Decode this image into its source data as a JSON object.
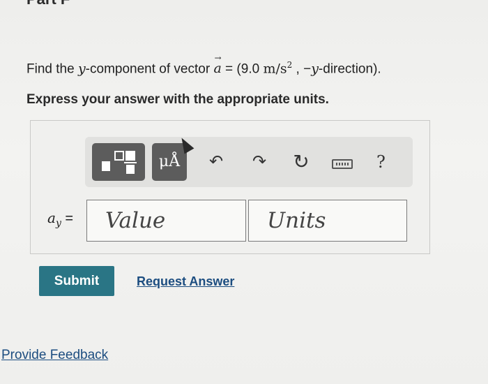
{
  "part": {
    "title": "Part F"
  },
  "question": {
    "prefix": "Find the ",
    "y_var": "y",
    "middle": "-component of vector ",
    "vector": "a",
    "equals": " = (9.0 ",
    "unit": "m/s",
    "exponent": "2",
    "sep": " , −",
    "y_var2": "y",
    "suffix": "-direction)."
  },
  "instructions": "Express your answer with the appropriate units.",
  "toolbar": {
    "units_label": "μÅ",
    "tools": [
      {
        "name": "undo-icon",
        "glyph": "↶"
      },
      {
        "name": "redo-icon",
        "glyph": "↷"
      },
      {
        "name": "reset-icon",
        "glyph": "↻"
      },
      {
        "name": "keyboard-icon",
        "glyph": ""
      },
      {
        "name": "help-icon",
        "glyph": "?"
      }
    ]
  },
  "answer": {
    "var_label": "a",
    "var_sub": "y",
    "equals": " =",
    "value_placeholder": "Value",
    "units_placeholder": "Units"
  },
  "actions": {
    "submit_label": "Submit",
    "request_answer_label": "Request Answer"
  },
  "footer": {
    "feedback_label": "Provide Feedback"
  }
}
